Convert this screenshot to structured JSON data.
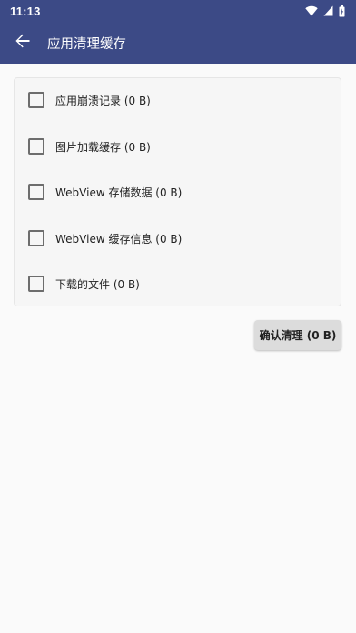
{
  "status_bar": {
    "time": "11:13",
    "icons": [
      "wifi-icon",
      "cellular-signal-icon",
      "battery-icon"
    ]
  },
  "app_bar": {
    "back_icon": "arrow-back-icon",
    "title": "应用清理缓存"
  },
  "options": [
    {
      "label": "应用崩溃记录 (0 B)",
      "checked": false
    },
    {
      "label": "图片加载缓存 (0 B)",
      "checked": false
    },
    {
      "label": "WebView 存储数据 (0 B)",
      "checked": false
    },
    {
      "label": "WebView 缓存信息 (0 B)",
      "checked": false
    },
    {
      "label": "下载的文件 (0 B)",
      "checked": false
    }
  ],
  "confirm_button": {
    "label": "确认清理 (0 B)"
  },
  "colors": {
    "primary": "#3c4a86",
    "background": "#fafafa",
    "card": "#f6f6f6",
    "button": "#dcdcdc"
  }
}
